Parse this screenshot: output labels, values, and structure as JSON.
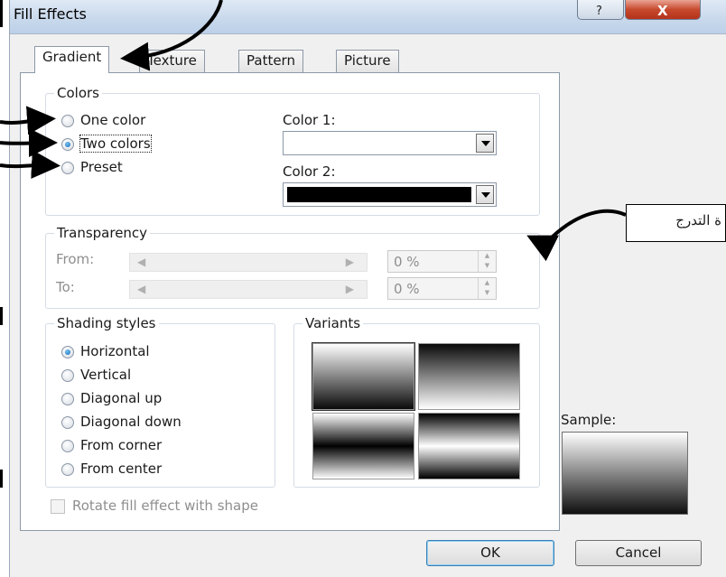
{
  "window": {
    "title": "Fill Effects",
    "help_glyph": "?",
    "close_glyph": "X"
  },
  "tabs": [
    {
      "label": "Gradient",
      "active": true
    },
    {
      "label": "Texture",
      "active": false
    },
    {
      "label": "Pattern",
      "active": false
    },
    {
      "label": "Picture",
      "active": false
    }
  ],
  "colors": {
    "group_label": "Colors",
    "options": [
      {
        "label": "One color",
        "selected": false
      },
      {
        "label": "Two colors",
        "selected": true
      },
      {
        "label": "Preset",
        "selected": false
      }
    ],
    "color1_label": "Color 1:",
    "color1_value": "#ffffff",
    "color2_label": "Color 2:",
    "color2_value": "#000000"
  },
  "transparency": {
    "group_label": "Transparency",
    "from_label": "From:",
    "from_value": "0 %",
    "to_label": "To:",
    "to_value": "0 %",
    "enabled": false
  },
  "shading": {
    "group_label": "Shading styles",
    "options": [
      {
        "label": "Horizontal",
        "selected": true
      },
      {
        "label": "Vertical",
        "selected": false
      },
      {
        "label": "Diagonal up",
        "selected": false
      },
      {
        "label": "Diagonal down",
        "selected": false
      },
      {
        "label": "From corner",
        "selected": false
      },
      {
        "label": "From center",
        "selected": false
      }
    ]
  },
  "variants": {
    "group_label": "Variants",
    "selected_index": 0
  },
  "sample": {
    "label": "Sample:"
  },
  "rotate_checkbox": {
    "label": "Rotate fill effect with shape",
    "checked": false,
    "enabled": false
  },
  "buttons": {
    "ok": "OK",
    "cancel": "Cancel"
  },
  "annotation": {
    "text": "ة التدرج"
  },
  "colors_theme": {
    "title_bar": "#c9d9ec",
    "close_button": "#c7492e",
    "dialog_bg": "#f0f0f0"
  }
}
